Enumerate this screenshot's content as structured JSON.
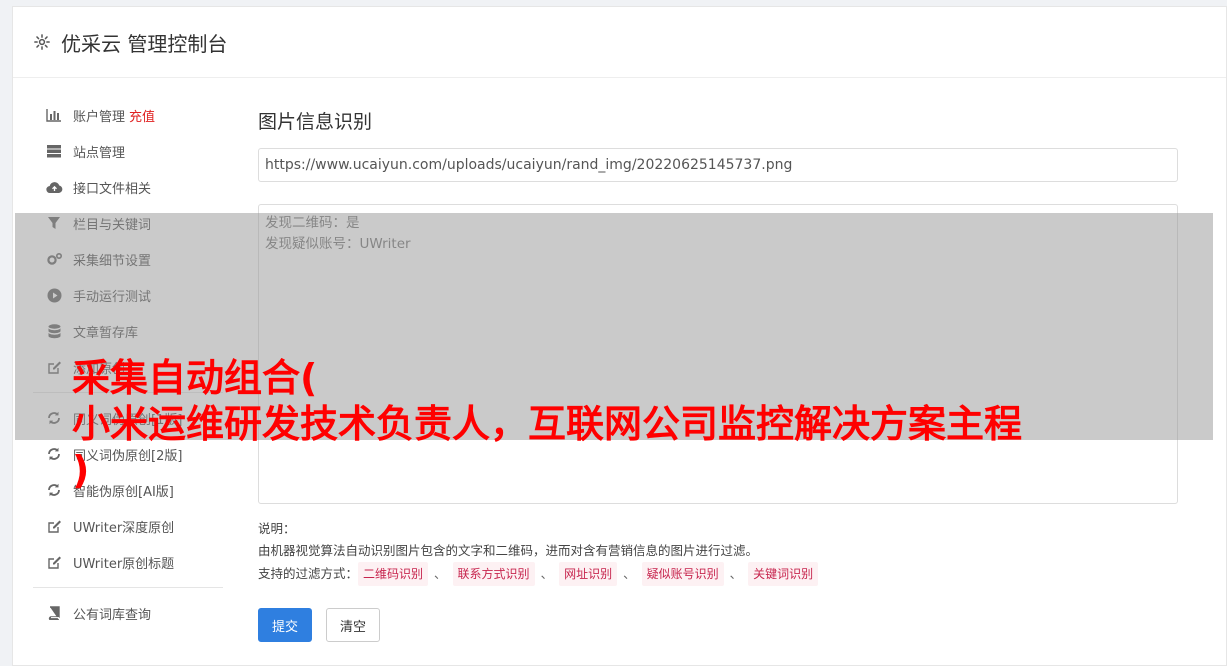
{
  "header": {
    "title": "优采云 管理控制台",
    "icon": "gear-icon"
  },
  "sidebar": {
    "items": [
      {
        "label": "账户管理",
        "tag": "充值",
        "icon": "bar-chart-icon"
      },
      {
        "label": "站点管理",
        "icon": "server-icon"
      },
      {
        "label": "接口文件相关",
        "icon": "cloud-upload-icon"
      },
      {
        "label": "栏目与关键词",
        "icon": "filter-icon"
      },
      {
        "label": "采集细节设置",
        "icon": "cogs-icon"
      },
      {
        "label": "手动运行测试",
        "icon": "play-circle-icon"
      },
      {
        "label": "文章暂存库",
        "icon": "database-icon"
      },
      {
        "label": "添加原创",
        "icon": "edit-icon"
      },
      {
        "label": "同义词伪原创[1版]",
        "icon": "refresh-icon"
      },
      {
        "label": "同义词伪原创[2版]",
        "icon": "refresh-icon"
      },
      {
        "label": "智能伪原创[AI版]",
        "icon": "refresh-icon"
      },
      {
        "label": "UWriter深度原创",
        "icon": "edit-icon"
      },
      {
        "label": "UWriter原创标题",
        "icon": "edit-icon"
      },
      {
        "label": "公有词库查询",
        "icon": "book-icon"
      }
    ]
  },
  "main": {
    "title": "图片信息识别",
    "url": "https://www.ucaiyun.com/uploads/ucaiyun/rand_img/20220625145737.png",
    "result_lines": [
      "发现二维码：是",
      "发现疑似账号：UWriter"
    ],
    "desc_label": "说明：",
    "desc_text": "由机器视觉算法自动识别图片包含的文字和二维码，进而对含有营销信息的图片进行过滤。",
    "filter_label": "支持的过滤方式：",
    "filters": [
      "二维码识别",
      "联系方式识别",
      "网址识别",
      "疑似账号识别",
      "关键词识别"
    ],
    "filter_sep": "、",
    "submit_label": "提交",
    "clear_label": "清空"
  },
  "overlay": {
    "line1": "采集自动组合(",
    "line2": "小米运维研发技术负责人，互联网公司监控解决方案主程",
    "line3": ")"
  }
}
